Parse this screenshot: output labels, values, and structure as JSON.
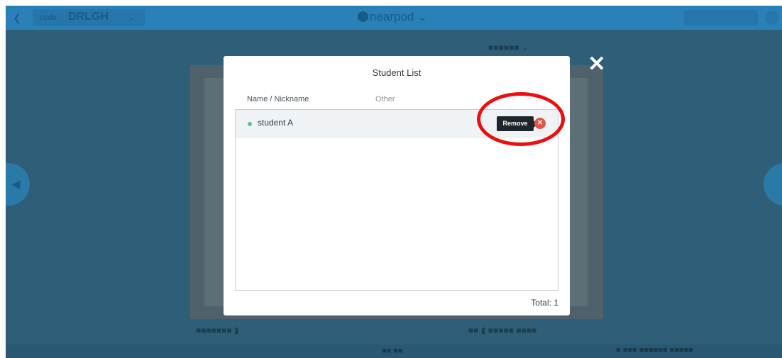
{
  "topbar": {
    "back_icon": "chevron-left-icon",
    "code_prefix": "code",
    "code_value": "DRLGH",
    "code_arrow": "⌄",
    "brand": "nearpod",
    "brand_arrow": "⌄",
    "right_button": "",
    "menu_icon": "circle-icon"
  },
  "background": {
    "slide_top_label": "■■■■■■ ⌄",
    "caption_left": "■■■■■■■ ▮",
    "caption_right": "■■ ▮ ■■■■■ ■■■■",
    "page_indicator": "■■ ■■",
    "bottom_label": "■  ■■■ ■■■■■■ ■■■■■"
  },
  "modal": {
    "title": "Student List",
    "columns": [
      "Name / Nickname",
      "Other"
    ],
    "students": [
      {
        "name": "student A",
        "status_color": "#5bc28a"
      }
    ],
    "remove_label": "Remove",
    "remove_icon": "x-circle-icon",
    "total_label": "Total: 1",
    "close_icon": "close-icon"
  },
  "annotation": {
    "highlight_color": "#ee0e0e"
  }
}
